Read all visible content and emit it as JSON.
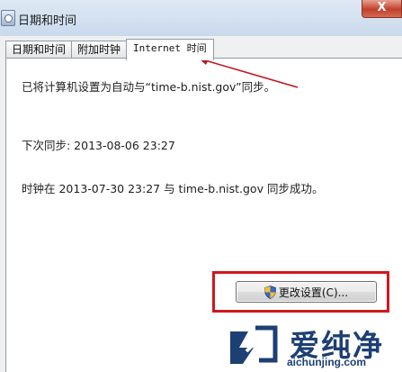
{
  "window": {
    "title": "日期和时间",
    "close_glyph": "X"
  },
  "tabs": [
    {
      "label": "日期和时间",
      "active": false
    },
    {
      "label": "附加时钟",
      "active": false
    },
    {
      "label": "Internet 时间",
      "active": true
    }
  ],
  "panel": {
    "sync_status": "已将计算机设置为自动与“time-b.nist.gov”同步。",
    "next_sync": "下次同步: 2013-08-06 23:27",
    "last_sync": "时钟在 2013-07-30 23:27 与 time-b.nist.gov 同步成功。",
    "change_button_label": "更改设置(C)..."
  },
  "annotations": {
    "highlight_color": "#d0181d",
    "arrow_color": "#c0141b"
  },
  "watermark": {
    "brand_cn": "爱纯净",
    "url": "aichunjing.com"
  }
}
